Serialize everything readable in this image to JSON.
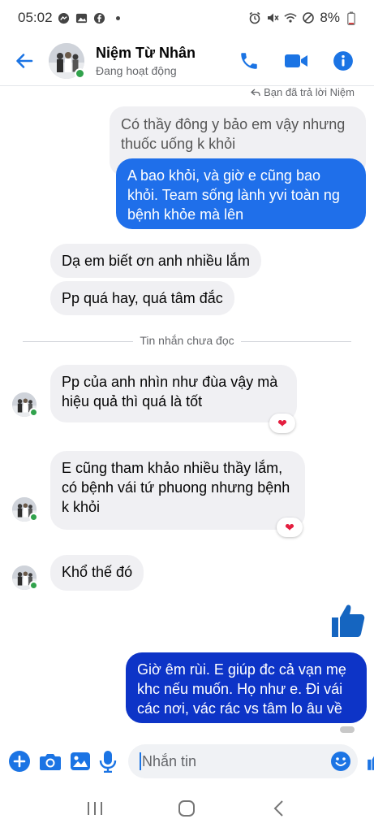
{
  "status_bar": {
    "time": "05:02",
    "battery": "8%"
  },
  "header": {
    "name": "Niệm Từ Nhân",
    "status": "Đang hoạt động"
  },
  "reply_note": "Bạn đã trả lời Niệm",
  "messages": [
    {
      "id": "quoted",
      "text": "Có thầy đông y bảo em vậy nhưng thuốc uống k khỏi"
    },
    {
      "id": "reply",
      "text": "A bao khỏi, và giờ e cũng bao khỏi. Team sống lành yvi toàn ng bệnh khỏe mà lên"
    },
    {
      "id": "m1",
      "text": "Dạ em biết ơn anh nhiều lắm"
    },
    {
      "id": "m2",
      "text": "Pp quá hay, quá tâm đắc"
    },
    {
      "id": "m3",
      "text": "Pp của anh nhìn như đùa vậy mà hiệu quả thì quá là tốt",
      "reaction": "heart"
    },
    {
      "id": "m4",
      "text": "E cũng tham khảo nhiều thầy lắm, có bệnh vái tứ phuong nhưng bệnh k khỏi",
      "reaction": "heart"
    },
    {
      "id": "m5",
      "text": "Khổ thế đó"
    },
    {
      "id": "m6",
      "text": "Giờ êm rùi. E giúp đc cả vạn mẹ khc nếu muốn. Họ như e. Đi vái các nơi, vác rác vs tâm lo âu về"
    }
  ],
  "unread_divider": "Tin nhắn chưa đọc",
  "composer": {
    "placeholder": "Nhắn tin"
  },
  "colors": {
    "messenger_blue": "#1b74e4",
    "outgoing_bubble": "#1f6fea",
    "outgoing_bubble_dark": "#0d34c7",
    "incoming_bubble": "#f0f0f3",
    "online_green": "#31a24c",
    "heart_red": "#e41e3f"
  }
}
